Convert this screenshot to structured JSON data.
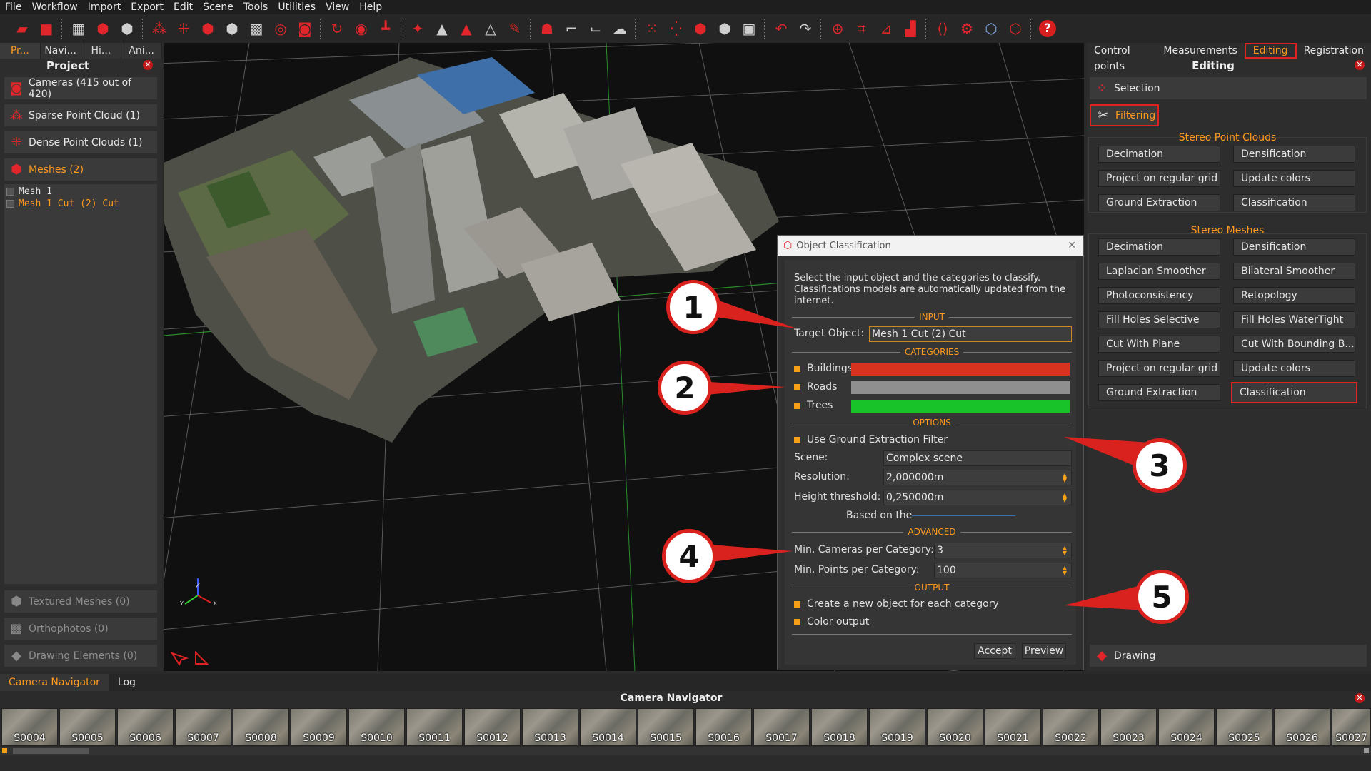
{
  "menu": [
    "File",
    "Workflow",
    "Import",
    "Export",
    "Edit",
    "Scene",
    "Tools",
    "Utilities",
    "View",
    "Help"
  ],
  "left_panel": {
    "tabs": [
      "Pr...",
      "Navi...",
      "Hi...",
      "Ani..."
    ],
    "title": "Project",
    "items": {
      "cameras": "Cameras (415 out of 420)",
      "sparse": "Sparse Point Cloud (1)",
      "dense": "Dense Point Clouds (1)",
      "meshes": "Meshes (2)",
      "textured": "Textured Meshes (0)",
      "ortho": "Orthophotos (0)",
      "drawing": "Drawing Elements (0)"
    },
    "mesh_list": [
      "Mesh 1",
      "Mesh 1 Cut (2) Cut"
    ]
  },
  "viewport": {
    "axis": {
      "z": "Z",
      "y": "Y",
      "x": "x"
    }
  },
  "right_panel": {
    "tabs": [
      "Control points",
      "Measurements",
      "Editing",
      "Registration"
    ],
    "active_tab": "Editing",
    "title": "Editing",
    "selection_label": "Selection",
    "filtering_label": "Filtering",
    "stereo_point_clouds": {
      "title": "Stereo Point Clouds",
      "buttons": [
        "Decimation",
        "Densification",
        "Project on regular grid",
        "Update colors",
        "Ground Extraction",
        "Classification"
      ]
    },
    "stereo_meshes": {
      "title": "Stereo Meshes",
      "buttons": [
        "Decimation",
        "Densification",
        "Laplacian Smoother",
        "Bilateral Smoother",
        "Photoconsistency",
        "Retopology",
        "Fill Holes Selective",
        "Fill Holes WaterTight",
        "Cut With Plane",
        "Cut With Bounding B...",
        "Project on regular grid",
        "Update colors",
        "Ground Extraction",
        "Classification"
      ]
    },
    "drawing_label": "Drawing"
  },
  "dialog": {
    "title": "Object Classification",
    "description": "Select the input object and the categories to classify. Classifications models are automatically updated from the internet.",
    "sections": {
      "input": "INPUT",
      "categories": "CATEGORIES",
      "options": "OPTIONS",
      "advanced": "ADVANCED",
      "output": "OUTPUT"
    },
    "target_label": "Target Object:",
    "target_value": "Mesh 1 Cut (2) Cut",
    "categories": [
      {
        "name": "Buildings",
        "color": "#d8331f"
      },
      {
        "name": "Roads",
        "color": "#8f8f8f"
      },
      {
        "name": "Trees",
        "color": "#18c32a"
      }
    ],
    "use_ground_filter": "Use Ground Extraction Filter",
    "scene_label": "Scene:",
    "scene_value": "Complex scene",
    "resolution_label": "Resolution:",
    "resolution_value": "2,000000m",
    "height_label": "Height threshold:",
    "height_value": "0,250000m",
    "based_on": "Based on the",
    "min_cameras_label": "Min. Cameras per Category:",
    "min_cameras_value": "3",
    "min_points_label": "Min. Points per Category:",
    "min_points_value": "100",
    "create_new": "Create a new object for each category",
    "color_output": "Color output",
    "accept": "Accept",
    "preview": "Preview"
  },
  "callouts": [
    "1",
    "2",
    "3",
    "4",
    "5"
  ],
  "bottom": {
    "tabs": [
      "Camera Navigator",
      "Log"
    ],
    "title": "Camera Navigator",
    "thumbs": [
      "S0004",
      "S0005",
      "S0006",
      "S0007",
      "S0008",
      "S0009",
      "S0010",
      "S0011",
      "S0012",
      "S0013",
      "S0014",
      "S0015",
      "S0016",
      "S0017",
      "S0018",
      "S0019",
      "S0020",
      "S0021",
      "S0022",
      "S0023",
      "S0024",
      "S0025",
      "S0026",
      "S0027"
    ]
  },
  "colors": {
    "accent": "#ff9a1f",
    "highlight": "#dd2222",
    "brand_red": "#e0262a"
  }
}
